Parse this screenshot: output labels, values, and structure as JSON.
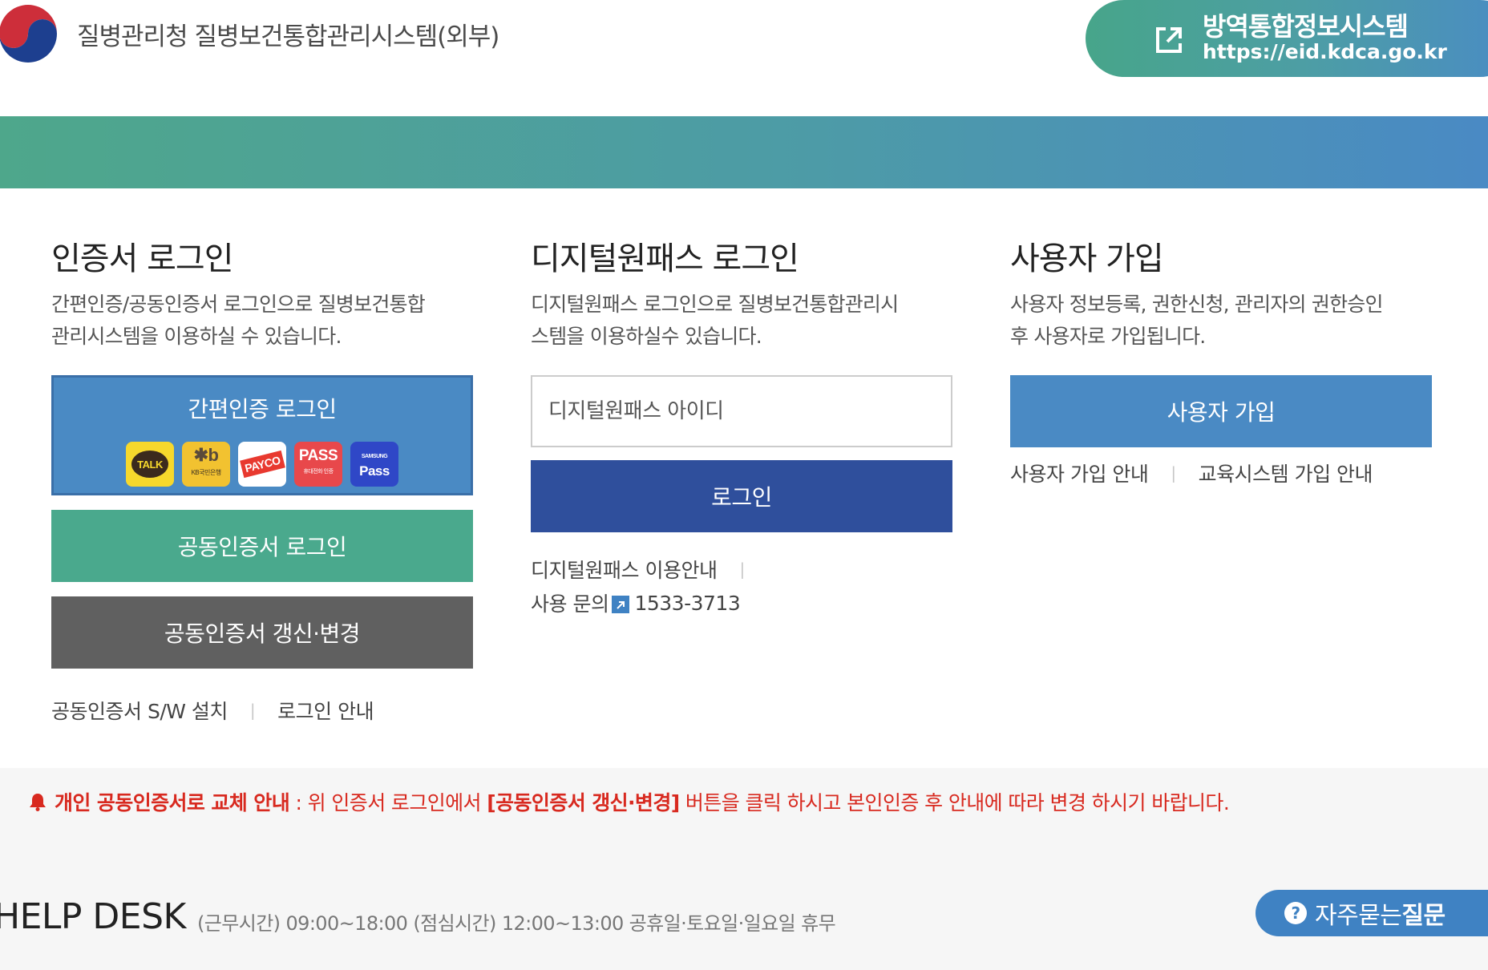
{
  "header": {
    "site_title": "질병관리청 질병보건통합관리시스템(외부)",
    "ext_link": {
      "title": "방역통합정보시스템",
      "url": "https://eid.kdca.go.kr"
    }
  },
  "cert_login": {
    "title": "인증서 로그인",
    "desc_line1": "간편인증/공동인증서 로그인으로 질병보건통합",
    "desc_line2": "관리시스템을 이용하실 수 있습니다.",
    "easy_login_label": "간편인증 로그인",
    "providers": [
      {
        "name": "kakao-talk",
        "label": "TALK"
      },
      {
        "name": "kb-bank",
        "label": "KB국민은행"
      },
      {
        "name": "payco",
        "label": "PAYCO"
      },
      {
        "name": "pass",
        "label": "PASS",
        "sub": "휴대전화 인증"
      },
      {
        "name": "samsung-pass",
        "label": "Pass",
        "sub": "SAMSUNG"
      }
    ],
    "cert_login_label": "공동인증서 로그인",
    "cert_renew_label": "공동인증서 갱신·변경",
    "link_sw_install": "공동인증서 S/W 설치",
    "link_login_guide": "로그인 안내"
  },
  "digital_pass": {
    "title": "디지털원패스 로그인",
    "desc_line1": "디지털원패스 로그인으로 질병보건통합관리시",
    "desc_line2": "스템을 이용하실수 있습니다.",
    "id_placeholder": "디지털원패스 아이디",
    "login_label": "로그인",
    "link_usage_guide": "디지털원패스 이용안내",
    "inquiry_label": "사용 문의",
    "inquiry_phone": "1533-3713"
  },
  "signup": {
    "title": "사용자 가입",
    "desc_line1": "사용자 정보등록, 권한신청, 관리자의 권한승인",
    "desc_line2": "후 사용자로 가입됩니다.",
    "signup_label": "사용자 가입",
    "link_signup_guide": "사용자 가입 안내",
    "link_edu_signup": "교육시스템 가입 안내"
  },
  "notice": {
    "headline": "개인 공동인증서로 교체 안내",
    "colon": " : 위 인증서 로그인에서 ",
    "button_ref": "[공동인증서 갱신·변경]",
    "rest": " 버튼을 클릭 하시고 본인인증 후 안내에 따라 변경 하시기 바랍니다."
  },
  "helpdesk": {
    "title": "HELP DESK",
    "hours": "(근무시간) 09:00~18:00 (점심시간) 12:00~13:00 공휴일·토요일·일요일 휴무",
    "faq_prefix": "자주묻는",
    "faq_bold": "질문"
  },
  "colors": {
    "green": "#4aa98d",
    "blue": "#4a8ac4",
    "navy": "#2f4f9c",
    "gray_button": "#606060",
    "notice_red": "#d8291f"
  }
}
